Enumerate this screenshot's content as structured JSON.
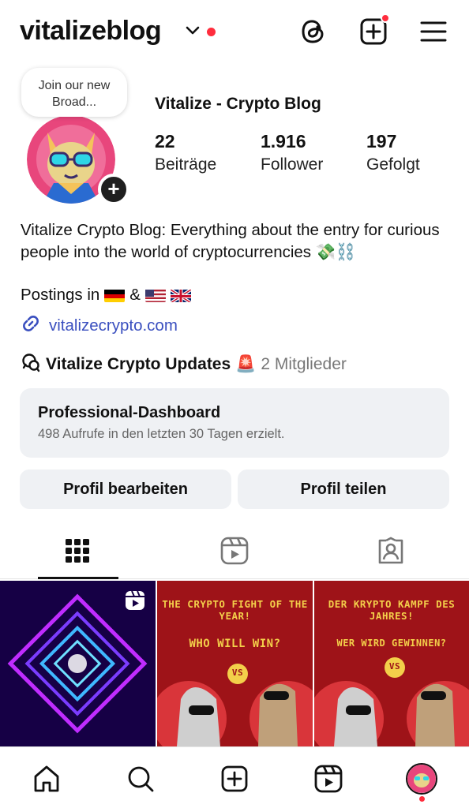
{
  "header": {
    "username": "vitalizeblog",
    "icons": [
      "chevron-down-icon",
      "threads-icon",
      "new-post-icon",
      "menu-icon"
    ],
    "notification_color": "#ff2d3d"
  },
  "note": {
    "text": "Join our new Broad..."
  },
  "profile": {
    "display_name": "Vitalize - Crypto Blog",
    "stats": [
      {
        "value": "22",
        "label": "Beiträge"
      },
      {
        "value": "1.916",
        "label": "Follower"
      },
      {
        "value": "197",
        "label": "Gefolgt"
      }
    ],
    "bio_line": "Vitalize Crypto Blog: Everything about the entry for curious people into the world of cryptocurrencies 💸⛓️",
    "postings_label": "Postings in",
    "postings_amp": "&",
    "link": "vitalizecrypto.com"
  },
  "channel": {
    "name": "Vitalize Crypto Updates",
    "emoji": "🚨",
    "members": "2 Mitglieder"
  },
  "dashboard": {
    "title": "Professional-Dashboard",
    "subtitle": "498 Aufrufe in den letzten 30 Tagen erzielt."
  },
  "buttons": {
    "edit": "Profil bearbeiten",
    "share": "Profil teilen"
  },
  "posts": [
    {
      "type": "reel"
    },
    {
      "line1": "THE CRYPTO FIGHT OF THE YEAR!",
      "line2": "WHO WILL WIN?",
      "vs": "VS"
    },
    {
      "line1": "DER KRYPTO KAMPF DES JAHRES!",
      "line2": "WER WIRD GEWINNEN?",
      "vs": "VS"
    }
  ],
  "colors": {
    "accent_link": "#3a4fbf",
    "button_bg": "#eff1f4"
  }
}
